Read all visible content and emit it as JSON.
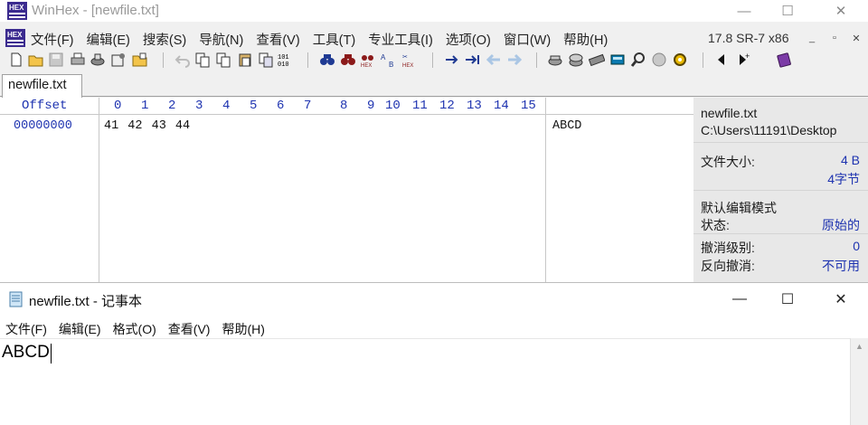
{
  "winhex": {
    "title": "WinHex - [newfile.txt]",
    "menu": [
      "文件(F)",
      "编辑(E)",
      "搜索(S)",
      "导航(N)",
      "查看(V)",
      "工具(T)",
      "专业工具(I)",
      "选项(O)",
      "窗口(W)",
      "帮助(H)"
    ],
    "version": "17.8 SR-7 x86",
    "tab_label": "newfile.txt",
    "hex_view": {
      "offset_header": "Offset",
      "column_numbers": [
        "0",
        "1",
        "2",
        "3",
        "4",
        "5",
        "6",
        "7",
        "8",
        "9",
        "10",
        "11",
        "12",
        "13",
        "14",
        "15"
      ],
      "offset_value": "00000000",
      "hex_bytes": "41 42 43 44",
      "ascii": "ABCD"
    },
    "info": {
      "filename": "newfile.txt",
      "path": "C:\\Users\\11191\\Desktop",
      "size_label": "文件大小:",
      "size_value": "4 B",
      "size_bytes": "4字节",
      "mode_label": "默认编辑模式",
      "state_label": "状态:",
      "state_value": "原始的",
      "undo_level_label": "撤消级别:",
      "undo_level_value": "0",
      "reverse_undo_label": "反向撤消:",
      "reverse_undo_value": "不可用"
    },
    "colors": {
      "offset_blue": "#1e33b0",
      "panel_bg": "#e8e8e8"
    }
  },
  "notepad": {
    "title": "newfile.txt - 记事本",
    "menu": [
      "文件(F)",
      "编辑(E)",
      "格式(O)",
      "查看(V)",
      "帮助(H)"
    ],
    "content": "ABCD"
  }
}
